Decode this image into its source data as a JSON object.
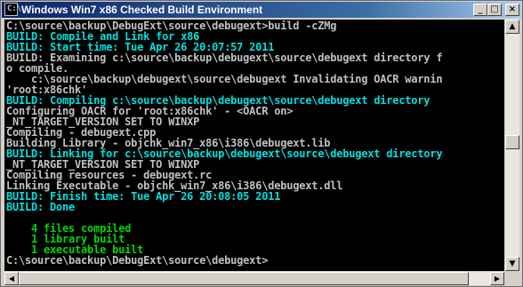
{
  "window": {
    "title": "Windows Win7 x86 Checked Build Environment",
    "icon": "cmd-icon",
    "controls": {
      "minimize": "_",
      "maximize": "□",
      "close": "×"
    }
  },
  "console": {
    "colors": {
      "default": "#c0c0c0",
      "build": "#00e0e0",
      "summary": "#00d800",
      "background": "#000000"
    },
    "lines": [
      {
        "text": "C:\\source\\backup\\DebugExt\\source\\debugext>build -cZMg",
        "color": "default"
      },
      {
        "text": "BUILD: Compile and Link for x86",
        "color": "build"
      },
      {
        "text": "BUILD: Start time: Tue Apr 26 20:07:57 2011",
        "color": "build"
      },
      {
        "text": "BUILD: Examining c:\\source\\backup\\debugext\\source\\debugext directory f",
        "color": "default"
      },
      {
        "text": "o compile.",
        "color": "default"
      },
      {
        "text": "    c:\\source\\backup\\debugext\\source\\debugext Invalidating OACR warnin",
        "color": "default"
      },
      {
        "text": "'root:x86chk'",
        "color": "default"
      },
      {
        "text": "BUILD: Compiling c:\\source\\backup\\debugext\\source\\debugext directory",
        "color": "build"
      },
      {
        "text": "Configuring OACR for 'root:x86chk' - <OACR on>",
        "color": "default"
      },
      {
        "text": "_NT_TARGET_VERSION SET TO WINXP",
        "color": "default"
      },
      {
        "text": "Compiling - debugext.cpp",
        "color": "default"
      },
      {
        "text": "Building Library - objchk_win7_x86\\i386\\debugext.lib",
        "color": "default"
      },
      {
        "text": "BUILD: Linking for c:\\source\\backup\\debugext\\source\\debugext directory",
        "color": "build"
      },
      {
        "text": "_NT_TARGET_VERSION SET TO WINXP",
        "color": "default"
      },
      {
        "text": "Compiling resources - debugext.rc",
        "color": "default"
      },
      {
        "text": "Linking Executable - objchk_win7_x86\\i386\\debugext.dll",
        "color": "default"
      },
      {
        "text": "BUILD: Finish time: Tue Apr 26 20:08:05 2011",
        "color": "build"
      },
      {
        "text": "BUILD: Done",
        "color": "build"
      },
      {
        "text": "",
        "color": "default"
      },
      {
        "text": "    4 files compiled",
        "color": "summary"
      },
      {
        "text": "    1 library built",
        "color": "summary"
      },
      {
        "text": "    1 executable built",
        "color": "summary"
      },
      {
        "text": "C:\\source\\backup\\DebugExt\\source\\debugext>",
        "color": "default"
      }
    ]
  },
  "scrollbars": {
    "up_arrow": "▲",
    "down_arrow": "▼",
    "left_arrow": "◀",
    "right_arrow": "▶"
  }
}
